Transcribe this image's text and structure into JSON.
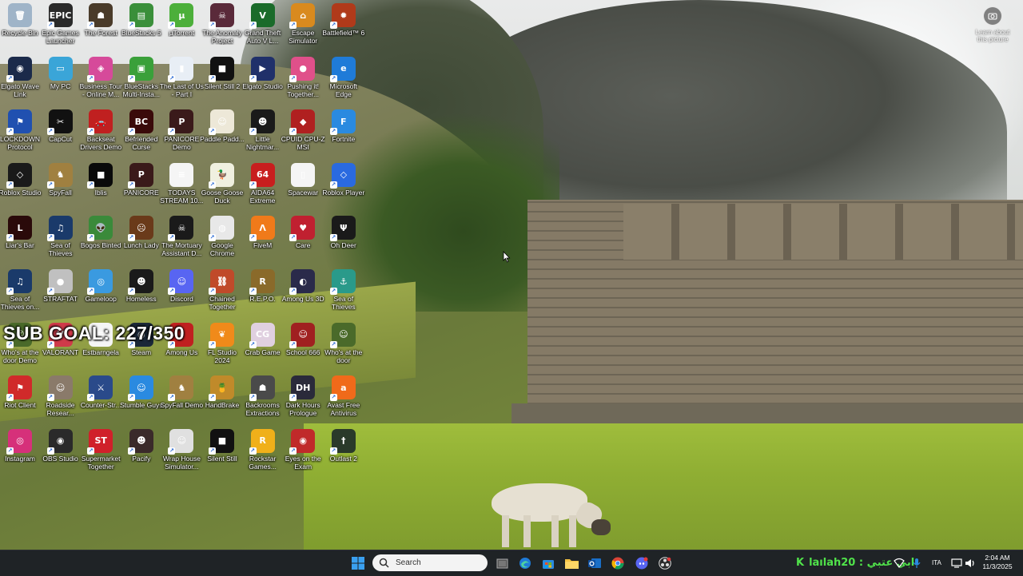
{
  "desktop_icons": [
    {
      "label": "Recycle Bin",
      "color": "#9fb4c8",
      "glyph": "🗑",
      "shortcut": false
    },
    {
      "label": "Epic Games Launcher",
      "color": "#2a2a2a",
      "glyph": "EPIC",
      "shortcut": true
    },
    {
      "label": "The Forest",
      "color": "#4a3b2a",
      "glyph": "☗",
      "shortcut": true
    },
    {
      "label": "BlueStacks 5",
      "color": "#3a8f3a",
      "glyph": "▤",
      "shortcut": true
    },
    {
      "label": "µTorrent",
      "color": "#4caf3a",
      "glyph": "µ",
      "shortcut": true
    },
    {
      "label": "The Anomaly Project",
      "color": "#5a2a3a",
      "glyph": "☠",
      "shortcut": true
    },
    {
      "label": "Grand Theft Auto V L...",
      "color": "#1a6b2a",
      "glyph": "V",
      "shortcut": true
    },
    {
      "label": "Escape Simulator",
      "color": "#d98a1e",
      "glyph": "⌂",
      "shortcut": true
    },
    {
      "label": "Battlefield™ 6",
      "color": "#b03a1a",
      "glyph": "✹",
      "shortcut": true
    },
    {
      "label": "Elgato Wave Link",
      "color": "#1b2a4a",
      "glyph": "◉",
      "shortcut": true
    },
    {
      "label": "My PC",
      "color": "#3aa5d8",
      "glyph": "▭",
      "shortcut": false
    },
    {
      "label": "Business Tour - Online M...",
      "color": "#d64a9a",
      "glyph": "◈",
      "shortcut": true
    },
    {
      "label": "BlueStacks Multi-Insta...",
      "color": "#3aa03a",
      "glyph": "▣",
      "shortcut": true
    },
    {
      "label": "The Last of Us - Part I",
      "color": "#e8eef5",
      "glyph": "▮",
      "shortcut": true
    },
    {
      "label": "Silent Still 2",
      "color": "#111111",
      "glyph": "■",
      "shortcut": true
    },
    {
      "label": "Elgato Studio",
      "color": "#20306a",
      "glyph": "▶",
      "shortcut": true
    },
    {
      "label": "Pushing it! Together...",
      "color": "#e0508a",
      "glyph": "●",
      "shortcut": true
    },
    {
      "label": "Microsoft Edge",
      "color": "#1f7bd8",
      "glyph": "e",
      "shortcut": true
    },
    {
      "label": "LOCKDOWN Protocol",
      "color": "#2050b0",
      "glyph": "⚑",
      "shortcut": true
    },
    {
      "label": "CapCut",
      "color": "#111111",
      "glyph": "✂",
      "shortcut": true
    },
    {
      "label": "Backseat Drivers Demo",
      "color": "#c02020",
      "glyph": "🚗",
      "shortcut": true
    },
    {
      "label": "Befriended Curse",
      "color": "#3a0a0a",
      "glyph": "BC",
      "shortcut": true
    },
    {
      "label": "PANICORE Demo",
      "color": "#3a1a1a",
      "glyph": "P",
      "shortcut": true
    },
    {
      "label": "Paddle Padd...",
      "color": "#ede8d8",
      "glyph": "☺",
      "shortcut": true
    },
    {
      "label": "Little Nightmar...",
      "color": "#1a1a1a",
      "glyph": "☻",
      "shortcut": true
    },
    {
      "label": "CPUID CPU-Z MSI",
      "color": "#b02020",
      "glyph": "◆",
      "shortcut": true
    },
    {
      "label": "Fortnite",
      "color": "#2a8ae0",
      "glyph": "F",
      "shortcut": true
    },
    {
      "label": "Roblox Studio",
      "color": "#1a1a1a",
      "glyph": "◇",
      "shortcut": true
    },
    {
      "label": "SpyFall",
      "color": "#a08040",
      "glyph": "♞",
      "shortcut": true
    },
    {
      "label": "Iblis",
      "color": "#0a0a0a",
      "glyph": "■",
      "shortcut": true
    },
    {
      "label": "PANICORE",
      "color": "#3a1a1a",
      "glyph": "P",
      "shortcut": true
    },
    {
      "label": "TODAYS STREAM 10...",
      "color": "#f5f5f5",
      "glyph": "≡",
      "shortcut": false
    },
    {
      "label": "Goose Goose Duck",
      "color": "#f0f0e0",
      "glyph": "🦆",
      "shortcut": true
    },
    {
      "label": "AIDA64 Extreme",
      "color": "#c81e1e",
      "glyph": "64",
      "shortcut": true
    },
    {
      "label": "Spacewar",
      "color": "#f5f5f5",
      "glyph": "▯",
      "shortcut": false
    },
    {
      "label": "Roblox Player",
      "color": "#2a6ae0",
      "glyph": "◇",
      "shortcut": true
    },
    {
      "label": "Liar's Bar",
      "color": "#2a0a0a",
      "glyph": "L",
      "shortcut": true
    },
    {
      "label": "Sea of Thieves",
      "color": "#1a3a6a",
      "glyph": "♫",
      "shortcut": true
    },
    {
      "label": "Bogos Binted",
      "color": "#3a8a3a",
      "glyph": "👽",
      "shortcut": true
    },
    {
      "label": "Lunch Lady",
      "color": "#6a3a1a",
      "glyph": "☹",
      "shortcut": true
    },
    {
      "label": "The Mortuary Assistant D...",
      "color": "#1a1a1a",
      "glyph": "☠",
      "shortcut": true
    },
    {
      "label": "Google Chrome",
      "color": "#e8e8e8",
      "glyph": "◍",
      "shortcut": true
    },
    {
      "label": "FiveM",
      "color": "#f07a1a",
      "glyph": "Λ",
      "shortcut": true
    },
    {
      "label": "Care",
      "color": "#c02030",
      "glyph": "♥",
      "shortcut": true
    },
    {
      "label": "Oh Deer",
      "color": "#1a1a1a",
      "glyph": "Ψ",
      "shortcut": true
    },
    {
      "label": "Sea of Thieves on...",
      "color": "#1a3a6a",
      "glyph": "♫",
      "shortcut": true
    },
    {
      "label": "STRAFTAT",
      "color": "#c0c0c0",
      "glyph": "●",
      "shortcut": true
    },
    {
      "label": "Gameloop",
      "color": "#3a9ae0",
      "glyph": "◎",
      "shortcut": true
    },
    {
      "label": "Homeless",
      "color": "#1a1a1a",
      "glyph": "☻",
      "shortcut": true
    },
    {
      "label": "Discord",
      "color": "#5865f2",
      "glyph": "☺",
      "shortcut": true
    },
    {
      "label": "Chained Together",
      "color": "#c04a2a",
      "glyph": "⛓",
      "shortcut": true
    },
    {
      "label": "R.E.P.O.",
      "color": "#8a6a2a",
      "glyph": "R",
      "shortcut": true
    },
    {
      "label": "Among Us 3D",
      "color": "#2a2a4a",
      "glyph": "◐",
      "shortcut": true
    },
    {
      "label": "Sea of Thieves",
      "color": "#2a9a8a",
      "glyph": "⚓",
      "shortcut": true
    },
    {
      "label": "Who's at the door Demo",
      "color": "#4a6a2a",
      "glyph": "☺",
      "shortcut": true
    },
    {
      "label": "VALORANT",
      "color": "#d03a4a",
      "glyph": "V",
      "shortcut": true
    },
    {
      "label": "Estbarngela",
      "color": "#f5f5f5",
      "glyph": "≡",
      "shortcut": false
    },
    {
      "label": "Steam",
      "color": "#1b2838",
      "glyph": "◉",
      "shortcut": true
    },
    {
      "label": "Among Us",
      "color": "#c02020",
      "glyph": "◖",
      "shortcut": true
    },
    {
      "label": "FL Studio 2024",
      "color": "#f08a1a",
      "glyph": "❦",
      "shortcut": true
    },
    {
      "label": "Crab Game",
      "color": "#e0d0e0",
      "glyph": "CG",
      "shortcut": true
    },
    {
      "label": "School 666",
      "color": "#a02020",
      "glyph": "☺",
      "shortcut": true
    },
    {
      "label": "Who's at the door",
      "color": "#4a6a2a",
      "glyph": "☺",
      "shortcut": true
    },
    {
      "label": "Riot Client",
      "color": "#d02a2a",
      "glyph": "⚑",
      "shortcut": true
    },
    {
      "label": "Roadside Resear...",
      "color": "#8a7a6a",
      "glyph": "☺",
      "shortcut": true
    },
    {
      "label": "Counter-Str...",
      "color": "#2a4a8a",
      "glyph": "⚔",
      "shortcut": true
    },
    {
      "label": "Stumble Guys",
      "color": "#2a8ae0",
      "glyph": "☺",
      "shortcut": true
    },
    {
      "label": "SpyFall Demo",
      "color": "#a08040",
      "glyph": "♞",
      "shortcut": true
    },
    {
      "label": "HandBrake",
      "color": "#c08a2a",
      "glyph": "🍍",
      "shortcut": true
    },
    {
      "label": "Backrooms Extractions",
      "color": "#4a4a4a",
      "glyph": "☗",
      "shortcut": true
    },
    {
      "label": "Dark Hours Prologue",
      "color": "#2a2a3a",
      "glyph": "DH",
      "shortcut": true
    },
    {
      "label": "Avast Free Antivirus",
      "color": "#f06a1a",
      "glyph": "a",
      "shortcut": true
    },
    {
      "label": "Instagram",
      "color": "#d6307a",
      "glyph": "◎",
      "shortcut": true
    },
    {
      "label": "OBS Studio",
      "color": "#2a2a2a",
      "glyph": "◉",
      "shortcut": true
    },
    {
      "label": "Supermarket Together",
      "color": "#d0202a",
      "glyph": "ST",
      "shortcut": true
    },
    {
      "label": "Pacify",
      "color": "#3a2a2a",
      "glyph": "☻",
      "shortcut": true
    },
    {
      "label": "Wrap House Simulator...",
      "color": "#e0e0e0",
      "glyph": "☺",
      "shortcut": true
    },
    {
      "label": "Silent Still",
      "color": "#111111",
      "glyph": "■",
      "shortcut": true
    },
    {
      "label": "Rockstar Games...",
      "color": "#f0b01a",
      "glyph": "R",
      "shortcut": true
    },
    {
      "label": "Eyes on the Exam",
      "color": "#c02a2a",
      "glyph": "◉",
      "shortcut": true
    },
    {
      "label": "Outlast 2",
      "color": "#2a3a2a",
      "glyph": "†",
      "shortcut": true
    }
  ],
  "overlay": {
    "sub_goal": "SUB GOAL: 227/350"
  },
  "learn_picture": {
    "label": "Learn about this picture"
  },
  "taskbar": {
    "search_placeholder": "Search",
    "stream_text": "laılah20 : ابي عتبي",
    "language": "ITA",
    "time": "2:04 AM",
    "date": "11/3/2025"
  },
  "colors": {
    "taskbar_bg": "#1f2326",
    "stream_text": "#50e24a",
    "windows_logo": "#3aa0f0"
  }
}
